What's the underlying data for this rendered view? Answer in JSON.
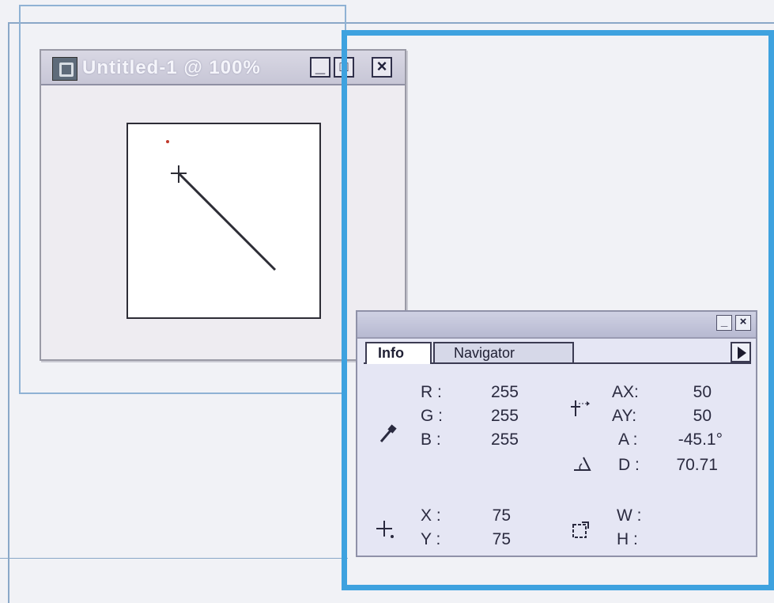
{
  "document_window": {
    "title": "Untitled-1 @ 100%",
    "buttons": {
      "minimize": "_",
      "maximize": "□",
      "close": "×"
    }
  },
  "info_panel": {
    "tabs": [
      {
        "label": "Info"
      },
      {
        "label": "Navigator"
      }
    ],
    "panel_buttons": {
      "minimize": "_",
      "close": "×"
    },
    "color": {
      "R_label": "R :",
      "R": "255",
      "G_label": "G :",
      "G": "255",
      "B_label": "B :",
      "B": "255"
    },
    "offset": {
      "AX_label": "AX:",
      "AX": "50",
      "AY_label": "AY:",
      "AY": "50"
    },
    "measure": {
      "A_label": "A :",
      "A": "-45.1°",
      "D_label": "D :",
      "D": "70.71"
    },
    "position": {
      "X_label": "X :",
      "X": "75",
      "Y_label": "Y :",
      "Y": "75"
    },
    "size": {
      "W_label": "W :",
      "W": "",
      "H_label": "H :",
      "H": ""
    }
  },
  "icons": [
    "eyedropper-icon",
    "offset-icon",
    "angle-icon",
    "crosshair-icon",
    "selection-size-icon"
  ]
}
